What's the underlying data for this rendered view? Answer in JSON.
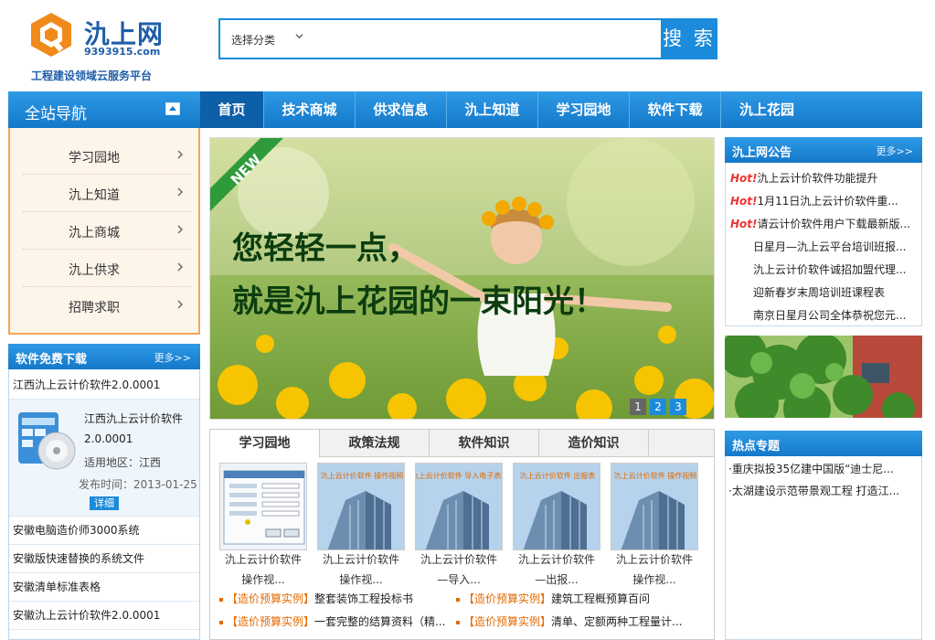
{
  "logo": {
    "name": "氿上网",
    "domain": "9393915.com",
    "slogan": "工程建设领域云服务平台",
    "colors": {
      "brand_blue": "#1f5ea8",
      "brand_orange": "#f08a1a"
    }
  },
  "search": {
    "category": "选择分类",
    "placeholder": "",
    "button": "搜 索"
  },
  "side_nav": {
    "title": "全站导航",
    "items": [
      "学习园地",
      "氿上知道",
      "氿上商城",
      "氿上供求",
      "招聘求职"
    ]
  },
  "main_nav": [
    "首页",
    "技术商城",
    "供求信息",
    "氿上知道",
    "学习园地",
    "软件下载",
    "氿上花园"
  ],
  "download": {
    "title": "软件免费下载",
    "more": "更多>>",
    "top_item": "江西氿上云计价软件2.0.0001",
    "feature": {
      "name": "江西氿上云计价软件",
      "version": "2.0.0001",
      "area": "适用地区：江西",
      "date": "发布时间：2013-01-25",
      "detail": "详细"
    },
    "items": [
      "安徽电脑造价师3000系统",
      "安徽版快速替换的系统文件",
      "安徽清单标准表格",
      "安徽氿上云计价软件2.0.0001"
    ]
  },
  "banner": {
    "badge": "NEW",
    "line1": "您轻轻一点，",
    "line2": "就是氿上花园的一束阳光！",
    "pages": [
      "1",
      "2",
      "3"
    ]
  },
  "tabs": {
    "labels": [
      "学习园地",
      "政策法规",
      "软件知识",
      "造价知识"
    ],
    "thumbs": [
      {
        "cap1": "氿上云计价软件",
        "cap2": "操作视...",
        "img_text": ""
      },
      {
        "cap1": "氿上云计价软件",
        "cap2": "操作视...",
        "img_text": "氿上云计价软件 操作视频"
      },
      {
        "cap1": "氿上云计价软件",
        "cap2": "—导入...",
        "img_text": "氿上云计价软件 导入电子表格"
      },
      {
        "cap1": "氿上云计价软件",
        "cap2": "—出报...",
        "img_text": "氿上云计价软件 出报表"
      },
      {
        "cap1": "氿上云计价软件",
        "cap2": "操作视...",
        "img_text": "氿上云计价软件 操作视频"
      }
    ],
    "news": [
      {
        "tag": "【造价预算实例】",
        "text": "整套装饰工程投标书"
      },
      {
        "tag": "【造价预算实例】",
        "text": "建筑工程概预算百问"
      },
      {
        "tag": "【造价预算实例】",
        "text": "一套完整的结算资料（精..."
      },
      {
        "tag": "【造价预算实例】",
        "text": "清单、定额两种工程量计..."
      }
    ]
  },
  "notice": {
    "title": "氿上网公告",
    "more": "更多>>",
    "hot_label": "Hot!",
    "items": [
      {
        "hot": true,
        "text": "氿上云计价软件功能提升"
      },
      {
        "hot": true,
        "text": "1月11日氿上云计价软件重..."
      },
      {
        "hot": true,
        "text": "请云计价软件用户下载最新版..."
      },
      {
        "hot": false,
        "text": "日星月—氿上云平台培训班报..."
      },
      {
        "hot": false,
        "text": "氿上云计价软件诚招加盟代理..."
      },
      {
        "hot": false,
        "text": "迎新春岁末周培训班课程表"
      },
      {
        "hot": false,
        "text": "南京日星月公司全体恭祝您元..."
      }
    ]
  },
  "topics": {
    "title": "热点专题",
    "items": [
      "·重庆拟投35亿建中国版“迪士尼...",
      "·太湖建设示范带景观工程 打造江..."
    ]
  }
}
